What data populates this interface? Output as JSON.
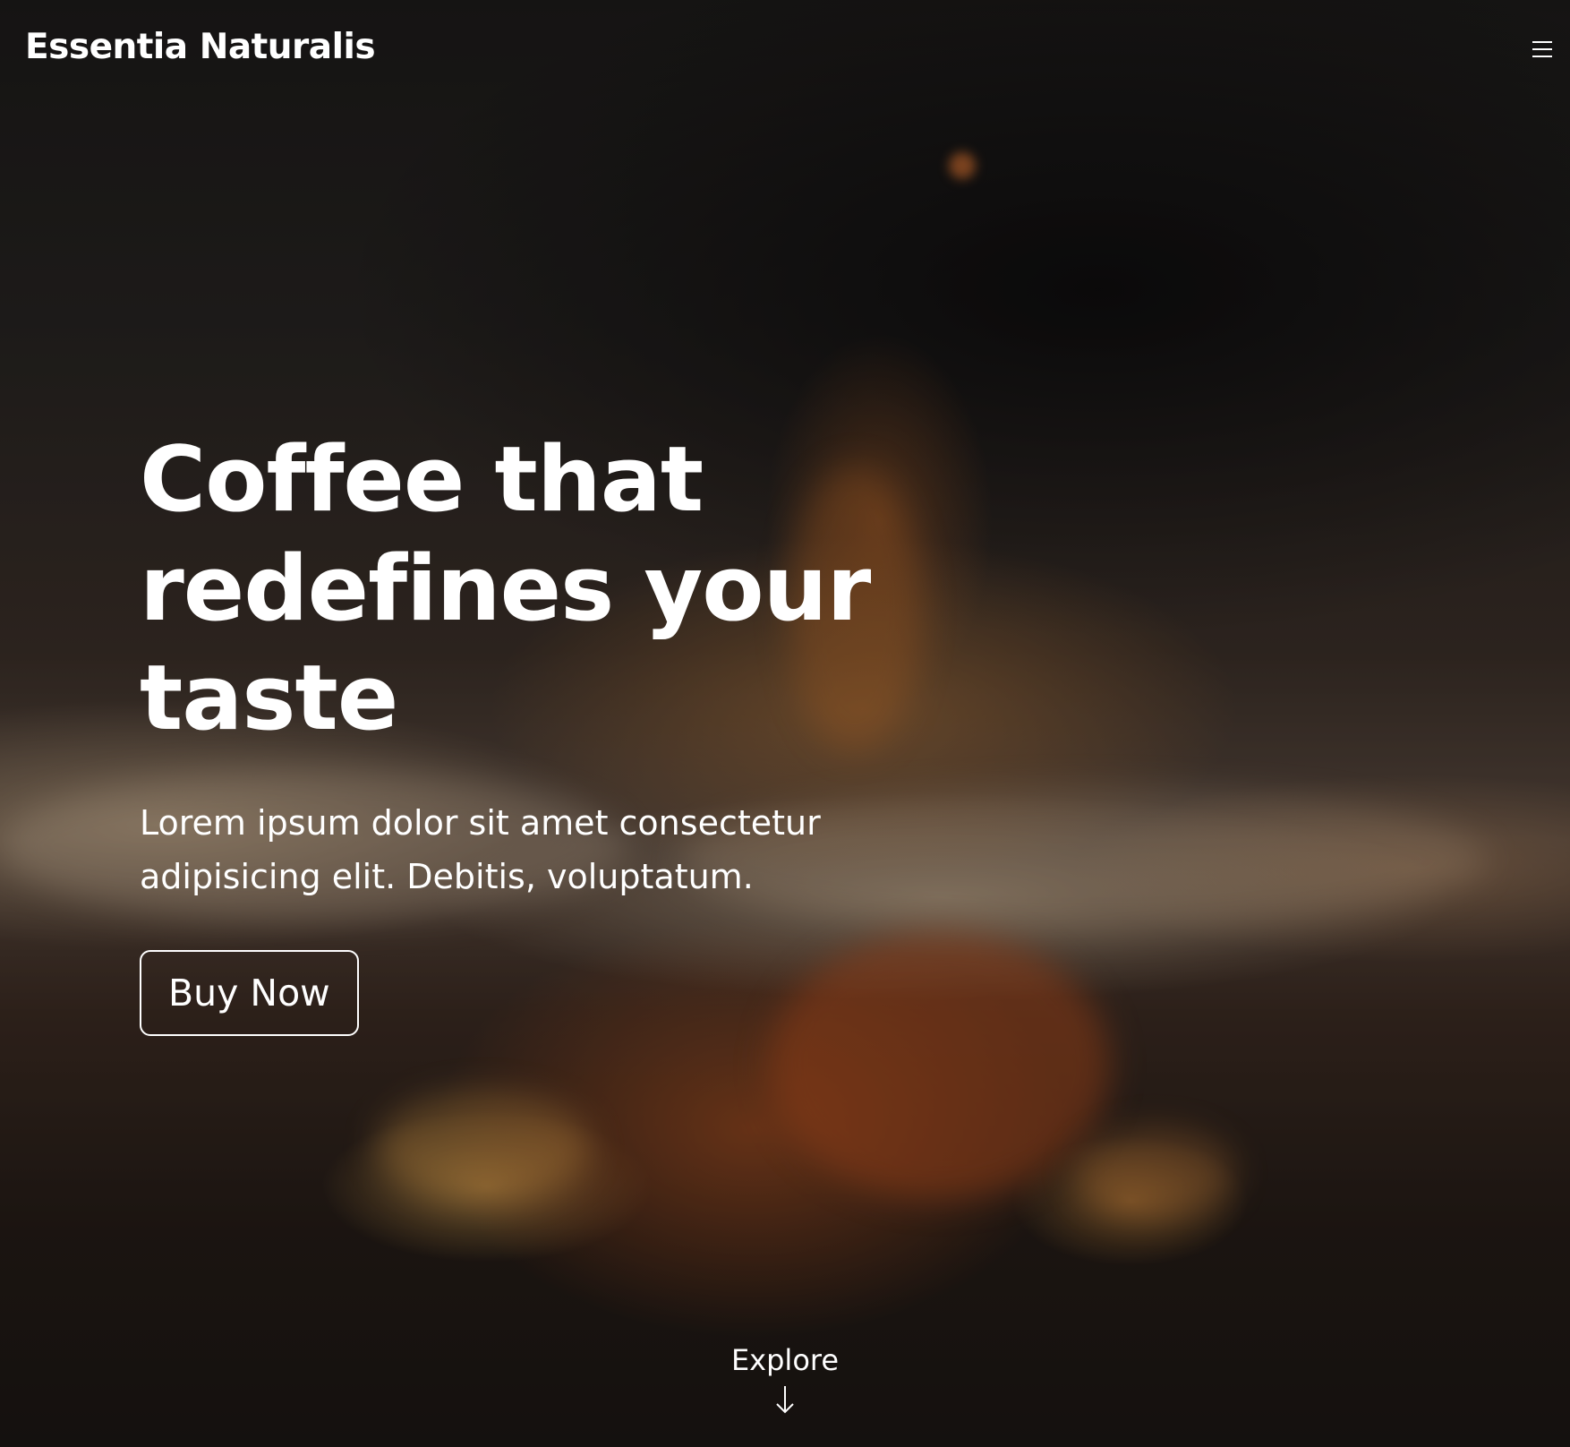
{
  "header": {
    "brand": "Essentia Naturalis",
    "menu_icon": "hamburger-menu-icon"
  },
  "hero": {
    "headline": "Coffee that\nredefines your\ntaste",
    "subtext": "Lorem ipsum dolor sit amet consectetur adipisicing elit. Debitis, voluptatum.",
    "cta_label": "Buy Now",
    "background_image": "blurred-campfire-photo"
  },
  "explore": {
    "label": "Explore",
    "icon": "arrow-down-icon"
  },
  "colors": {
    "text": "#ffffff",
    "overlay": "#080606",
    "fire_glow": "#c47e3a",
    "ember": "#aa4e1e"
  }
}
